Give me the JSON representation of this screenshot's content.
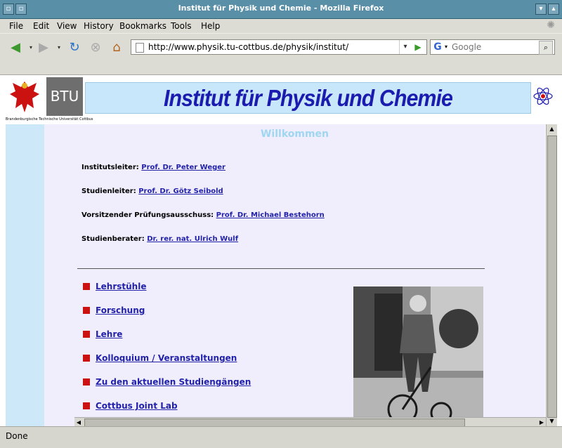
{
  "window": {
    "title": "Institut für Physik und Chemie - Mozilla Firefox"
  },
  "menu": [
    "File",
    "Edit",
    "View",
    "History",
    "Bookmarks",
    "Tools",
    "Help"
  ],
  "nav": {
    "url": "http://www.physik.tu-cottbus.de/physik/institut/",
    "search_placeholder": "Google"
  },
  "page": {
    "logo_text": "BTU",
    "logo_subtext": "Brandenburgische Technische Universität Cottbus",
    "banner_title": "Institut für Physik und Chemie",
    "welcome": "Willkommen",
    "info": [
      {
        "label": "Institutsleiter:",
        "link": "Prof. Dr. Peter Weger"
      },
      {
        "label": "Studienleiter:",
        "link": "Prof. Dr. Götz Seibold"
      },
      {
        "label": "Vorsitzender Prüfungsausschuss:",
        "link": "Prof. Dr. Michael Bestehorn"
      },
      {
        "label": "Studienberater:",
        "link": "Dr. rer. nat. Ulrich Wulf"
      }
    ],
    "nav_links": [
      "Lehrstühle",
      "Forschung",
      "Lehre",
      "Kolloquium / Veranstaltungen",
      "Zu den aktuellen Studiengängen",
      "Cottbus Joint Lab"
    ]
  },
  "status": {
    "text": "Done"
  },
  "colors": {
    "titlebar": "#5a8fa8",
    "banner_text": "#1b1bb0",
    "link": "#2222aa",
    "bullet": "#cc1111"
  }
}
